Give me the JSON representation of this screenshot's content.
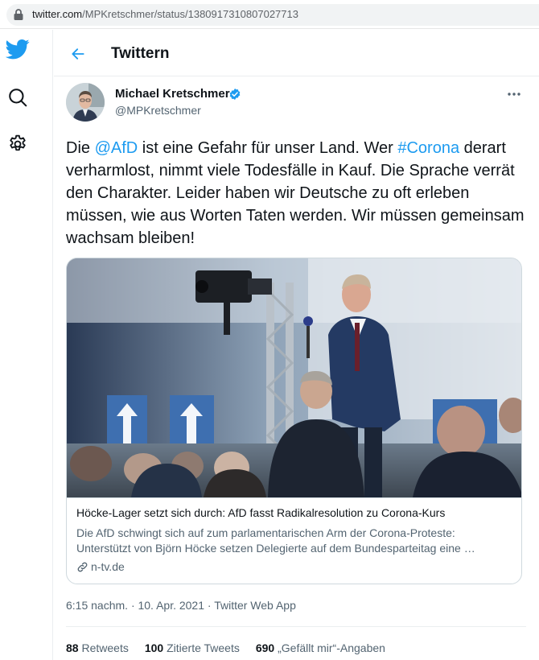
{
  "browser": {
    "url_host": "twitter.com",
    "url_path": "/MPKretschmer/status/1380917310807027713"
  },
  "nav": {
    "items": [
      {
        "icon": "twitter-bird-icon"
      },
      {
        "icon": "search-icon"
      },
      {
        "icon": "gear-icon"
      }
    ]
  },
  "header": {
    "title": "Twittern"
  },
  "tweet": {
    "author_name": "Michael Kretschmer",
    "author_handle": "@MPKretschmer",
    "text_parts": [
      {
        "text": "Die ",
        "link": false
      },
      {
        "text": "@AfD",
        "link": true
      },
      {
        "text": " ist eine Gefahr für unser Land. Wer ",
        "link": false
      },
      {
        "text": "#Corona",
        "link": true
      },
      {
        "text": " derart verharmlost, nimmt viele Todesfälle in Kauf. Die Sprache verrät den Charakter. Leider haben wir Deutsche zu oft erleben müssen, wie aus Worten Taten werden. Wir müssen gemeinsam wachsam bleiben!",
        "link": false
      }
    ],
    "card": {
      "title": "Höcke-Lager setzt sich durch: AfD fasst Radikalresolution zu Corona-Kurs",
      "description": "Die AfD schwingt sich auf zum parlamentarischen Arm der Corona-Proteste: Unterstützt von Björn Höcke setzen Delegierte auf dem Bundesparteitag eine …",
      "domain": "n-tv.de"
    },
    "meta": "6:15 nachm. · 10. Apr. 2021 · Twitter Web App",
    "stats": {
      "retweets_count": "88",
      "retweets_label": "Retweets",
      "quotes_count": "100",
      "quotes_label": "Zitierte Tweets",
      "likes_count": "690",
      "likes_label": "„Gefällt mir“-Angaben"
    }
  },
  "colors": {
    "accent": "#1d9bf0",
    "text": "#0f1419",
    "secondary": "#536471",
    "border": "#cfd9de"
  }
}
